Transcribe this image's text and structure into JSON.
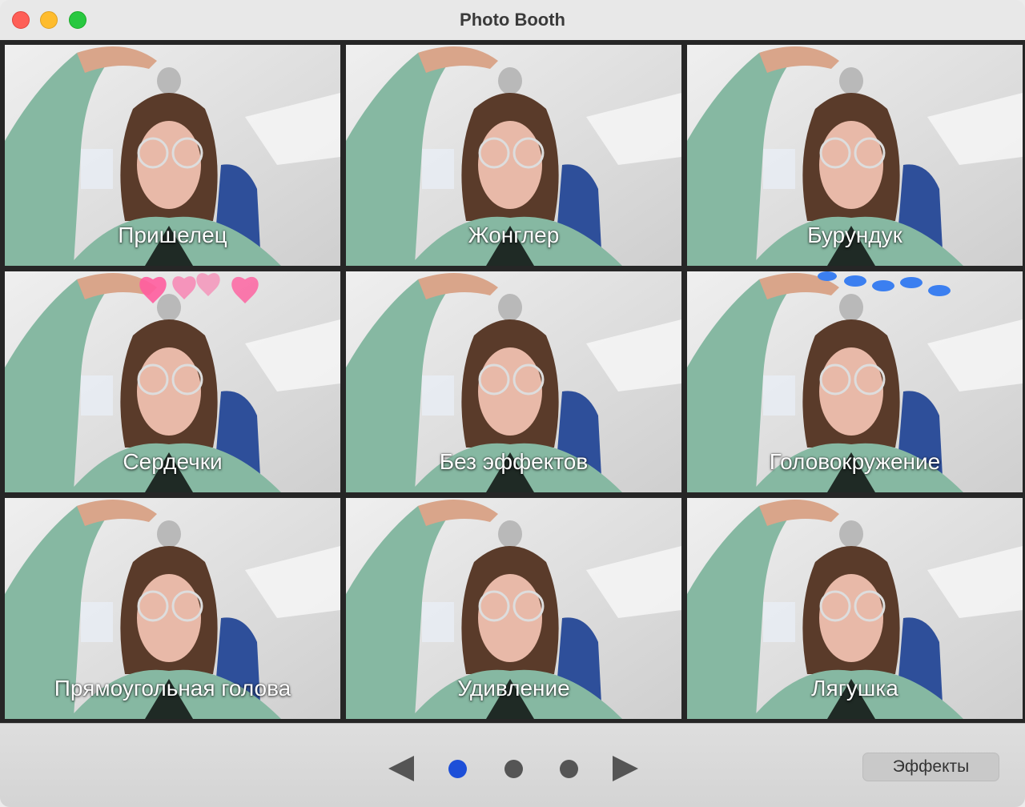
{
  "window": {
    "title": "Photo Booth"
  },
  "effects": [
    {
      "label": "Пришелец"
    },
    {
      "label": "Жонглер"
    },
    {
      "label": "Бурундук"
    },
    {
      "label": "Сердечки"
    },
    {
      "label": "Без эффектов"
    },
    {
      "label": "Головокружение"
    },
    {
      "label": "Прямоугольная голова"
    },
    {
      "label": "Удивление"
    },
    {
      "label": "Лягушка"
    }
  ],
  "pager": {
    "pages": 3,
    "current_page": 1
  },
  "toolbar": {
    "effects_button_label": "Эффекты"
  },
  "colors": {
    "close": "#fe5f57",
    "minimize": "#febc2e",
    "maximize": "#28c840",
    "active_dot": "#1d4fd8",
    "hoodie": "#86b8a2",
    "hair": "#5a3b2a",
    "chair": "#2e4f9a",
    "hearts": "#ff5d9e",
    "birds": "#3b7ff0"
  }
}
